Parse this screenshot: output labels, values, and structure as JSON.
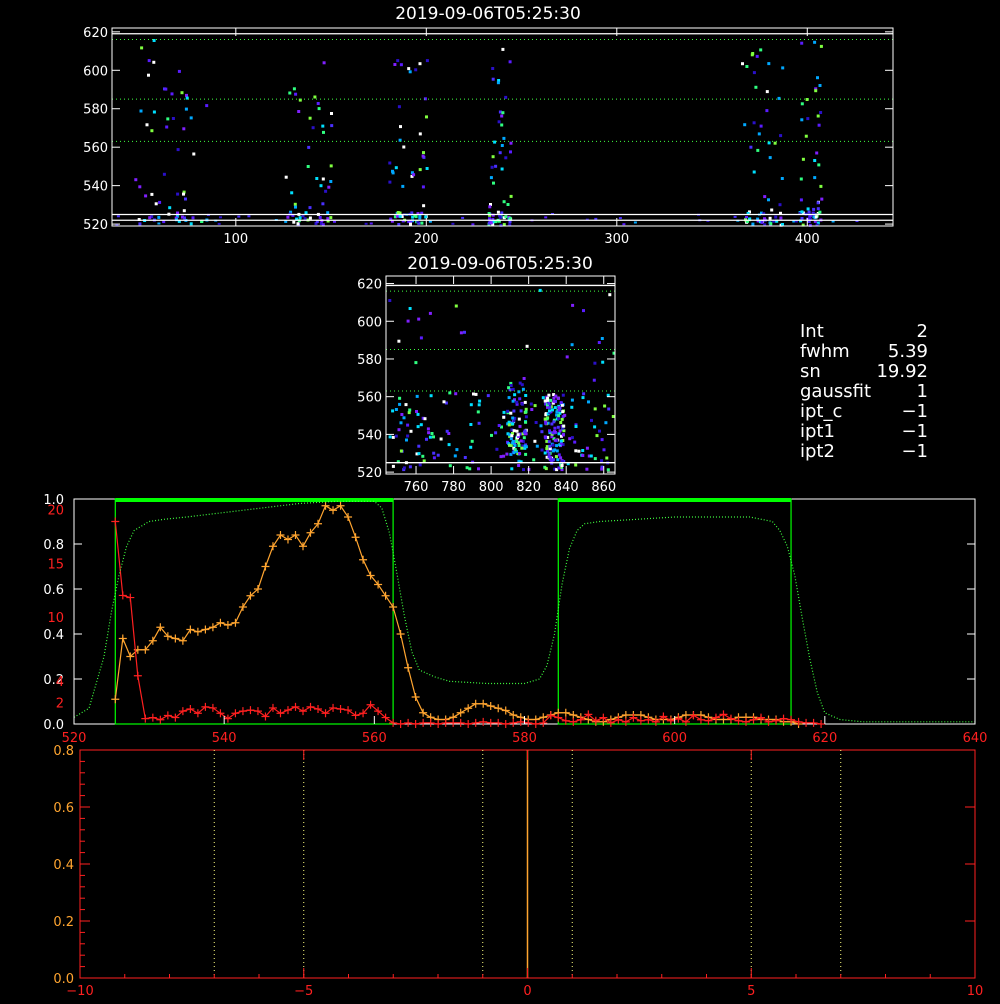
{
  "colors": {
    "axis": "#ffffff",
    "red": "#ff2020",
    "orange": "#ffa530",
    "green": "#00ff00",
    "green_dot": "#40ff40",
    "yellow_dot": "#ffff80"
  },
  "info_panel": [
    {
      "key": "Int",
      "value": "2"
    },
    {
      "key": "fwhm",
      "value": "5.39"
    },
    {
      "key": "sn",
      "value": "19.92"
    },
    {
      "key": "gaussfit",
      "value": "1"
    },
    {
      "key": "ipt_c",
      "value": "−1"
    },
    {
      "key": "ipt1",
      "value": "−1"
    },
    {
      "key": "ipt2",
      "value": "−1"
    }
  ],
  "chart_data": [
    {
      "id": "top_image",
      "type": "heatmap",
      "title": "2019-09-06T05:25:30",
      "xlim": [
        35,
        445
      ],
      "ylim": [
        519,
        622
      ],
      "x_ticks": [
        100,
        200,
        300,
        400
      ],
      "y_ticks": [
        520,
        540,
        560,
        580,
        600,
        620
      ],
      "solid_lines": [
        619,
        525,
        522
      ],
      "dotted_lines": [
        616,
        585,
        563
      ],
      "hot_columns": [
        {
          "x": 45,
          "w": 40
        },
        {
          "x": 125,
          "w": 25
        },
        {
          "x": 180,
          "w": 20
        },
        {
          "x": 232,
          "w": 12
        },
        {
          "x": 365,
          "w": 22
        },
        {
          "x": 395,
          "w": 12
        }
      ]
    },
    {
      "id": "zoom_image",
      "type": "heatmap",
      "title": "2019-09-06T05:25:30",
      "xlim": [
        744,
        866
      ],
      "ylim": [
        519,
        624
      ],
      "x_ticks": [
        760,
        780,
        800,
        820,
        840,
        860
      ],
      "y_ticks": [
        520,
        540,
        560,
        580,
        600,
        620
      ],
      "solid_lines": [
        619,
        525
      ],
      "dotted_lines": [
        616,
        585,
        563
      ]
    },
    {
      "id": "spectrum",
      "type": "line",
      "xlim": [
        520,
        640
      ],
      "x_ticks": [
        520,
        540,
        560,
        580,
        600,
        620,
        640
      ],
      "left_axis_white": {
        "ylim": [
          0,
          1
        ],
        "ticks": [
          0.0,
          0.2,
          0.4,
          0.6,
          0.8
        ],
        "tick_labels": [
          "0.0",
          "0.2",
          "0.4",
          "0.6",
          "0.8",
          "1.0"
        ]
      },
      "left_axis_red": {
        "ylim": [
          0,
          21
        ],
        "ticks": [
          2,
          4,
          10,
          15,
          20
        ],
        "tick_labels": [
          "2",
          "4",
          "10",
          "15",
          "20"
        ]
      },
      "pass_bands": [
        [
          525.5,
          562.5
        ],
        [
          584.5,
          615.5
        ]
      ],
      "series": [
        {
          "color": "orange",
          "axis": "white",
          "marker": "plus",
          "x": [
            525.5,
            526.5,
            527.5,
            528.5,
            529.5,
            530.5,
            531.5,
            532.5,
            533.5,
            534.5,
            535.5,
            536.5,
            537.5,
            538.5,
            539.5,
            540.5,
            541.5,
            542.5,
            543.5,
            544.5,
            545.5,
            546.5,
            547.5,
            548.5,
            549.5,
            550.5,
            551.5,
            552.5,
            553.5,
            554.5,
            555.5,
            556.5,
            557.5,
            558.5,
            559.5,
            560.5,
            561.5,
            562.5,
            563.5,
            564.5,
            565.5,
            566.5,
            567.5,
            568.5,
            569.5,
            570.5,
            571.5,
            572.5,
            573.5,
            574.5,
            575.5,
            576.5,
            577.5,
            578.5,
            579.5,
            580.5,
            581.5,
            582.5,
            583.5,
            584.5,
            585.5,
            586.5,
            587.5,
            588.5,
            589.5,
            590.5,
            591.5,
            592.5,
            593.5,
            594.5,
            595.5,
            596.5,
            597.5,
            598.5,
            599.5,
            600.5,
            601.5,
            602.5,
            603.5,
            604.5,
            605.5,
            606.5,
            607.5,
            608.5,
            609.5,
            610.5,
            611.5,
            612.5,
            613.5,
            614.5,
            615.5,
            616.5
          ],
          "y": [
            0.11,
            0.38,
            0.3,
            0.33,
            0.33,
            0.37,
            0.43,
            0.39,
            0.38,
            0.37,
            0.42,
            0.41,
            0.42,
            0.43,
            0.45,
            0.44,
            0.45,
            0.52,
            0.57,
            0.6,
            0.7,
            0.79,
            0.84,
            0.82,
            0.84,
            0.79,
            0.85,
            0.89,
            0.97,
            0.95,
            0.97,
            0.92,
            0.83,
            0.73,
            0.66,
            0.62,
            0.57,
            0.52,
            0.4,
            0.25,
            0.12,
            0.05,
            0.03,
            0.02,
            0.02,
            0.03,
            0.05,
            0.07,
            0.09,
            0.09,
            0.08,
            0.07,
            0.06,
            0.04,
            0.03,
            0.02,
            0.02,
            0.03,
            0.04,
            0.05,
            0.05,
            0.04,
            0.03,
            0.02,
            0.01,
            0.01,
            0.02,
            0.03,
            0.04,
            0.04,
            0.04,
            0.03,
            0.02,
            0.02,
            0.02,
            0.03,
            0.04,
            0.04,
            0.04,
            0.03,
            0.02,
            0.02,
            0.02,
            0.03,
            0.03,
            0.03,
            0.02,
            0.02,
            0.02,
            0.01,
            0.01,
            0.0
          ]
        },
        {
          "color": "red",
          "axis": "red",
          "marker": "plus",
          "x": [
            525.5,
            526.5,
            527.5,
            528.5,
            529.5,
            530.5,
            531.5,
            532.5,
            533.5,
            534.5,
            535.5,
            536.5,
            537.5,
            538.5,
            539.5,
            540.5,
            541.5,
            542.5,
            543.5,
            544.5,
            545.5,
            546.5,
            547.5,
            548.5,
            549.5,
            550.5,
            551.5,
            552.5,
            553.5,
            554.5,
            555.5,
            556.5,
            557.5,
            558.5,
            559.5,
            560.5,
            561.5,
            562.5,
            563.5,
            564.5,
            565.5,
            566.5,
            567.5,
            568.5,
            569.5,
            570.5,
            571.5,
            572.5,
            573.5,
            574.5,
            575.5,
            576.5,
            577.5,
            578.5,
            579.5,
            580.5,
            581.5,
            582.5,
            583.5,
            584.5,
            585.5,
            586.5,
            587.5,
            588.5,
            589.5,
            590.5,
            591.5,
            592.5,
            593.5,
            594.5,
            595.5,
            596.5,
            597.5,
            598.5,
            599.5,
            600.5,
            601.5,
            602.5,
            603.5,
            604.5,
            605.5,
            606.5,
            607.5,
            608.5,
            609.5,
            610.5,
            611.5,
            612.5,
            613.5,
            614.5,
            615.5,
            616.5,
            617.5,
            618.5,
            619.5
          ],
          "y": [
            18.9,
            12.0,
            11.8,
            4.5,
            0.5,
            0.6,
            0.4,
            0.8,
            0.6,
            1.2,
            1.4,
            1.0,
            1.6,
            1.5,
            1.0,
            0.5,
            1.0,
            1.2,
            1.3,
            1.2,
            0.7,
            1.5,
            1.0,
            1.3,
            1.6,
            1.2,
            1.6,
            1.4,
            1.0,
            1.5,
            1.4,
            1.3,
            0.8,
            1.0,
            1.8,
            1.2,
            0.6,
            0.1,
            0.0,
            0.1,
            0.0,
            0.1,
            0.1,
            0.0,
            0.1,
            0.1,
            0.1,
            0.0,
            0.1,
            0.2,
            0.1,
            0.1,
            0.0,
            0.1,
            0.2,
            0.1,
            0.0,
            0.1,
            0.8,
            0.6,
            0.3,
            0.2,
            0.4,
            0.9,
            0.3,
            0.6,
            0.1,
            0.4,
            0.2,
            0.6,
            0.3,
            0.4,
            0.2,
            0.7,
            0.3,
            0.5,
            0.2,
            0.8,
            0.4,
            0.3,
            0.6,
            0.9,
            0.5,
            0.3,
            0.2,
            0.4,
            0.6,
            0.2,
            0.3,
            0.5,
            0.4,
            0.2,
            0.1,
            0.1,
            0.0
          ]
        },
        {
          "color": "green_dot",
          "axis": "white",
          "marker": "none",
          "style": "dotted",
          "x": [
            520,
            522,
            524,
            525,
            526,
            527,
            528,
            530,
            532,
            535,
            540,
            545,
            550,
            555,
            560,
            561,
            562,
            563,
            564,
            565,
            566,
            568,
            570,
            575,
            580,
            582,
            583,
            584,
            585,
            586,
            587,
            588,
            590,
            595,
            600,
            605,
            610,
            613,
            614,
            615,
            616,
            617,
            618,
            619,
            620,
            622,
            625,
            630,
            640
          ],
          "y": [
            0.03,
            0.07,
            0.3,
            0.5,
            0.66,
            0.79,
            0.86,
            0.9,
            0.91,
            0.92,
            0.94,
            0.96,
            0.98,
            0.99,
            0.99,
            0.96,
            0.85,
            0.67,
            0.48,
            0.32,
            0.24,
            0.21,
            0.19,
            0.18,
            0.18,
            0.2,
            0.26,
            0.4,
            0.62,
            0.78,
            0.86,
            0.89,
            0.9,
            0.91,
            0.92,
            0.92,
            0.92,
            0.9,
            0.86,
            0.79,
            0.66,
            0.47,
            0.29,
            0.14,
            0.05,
            0.02,
            0.01,
            0.01,
            0.01
          ]
        }
      ]
    },
    {
      "id": "offset_panel",
      "type": "line",
      "xlim": [
        -10,
        10
      ],
      "ylim": [
        0,
        0.8
      ],
      "x_ticks": [
        -10,
        -5,
        0,
        5,
        10
      ],
      "y_ticks": [
        0.0,
        0.2,
        0.4,
        0.6,
        0.8
      ],
      "y_tick_labels": [
        "0.0",
        "0.2",
        "0.4",
        "0.6",
        "0.8"
      ],
      "vlines_dotted": [
        -7,
        -5,
        -1,
        1,
        5,
        7
      ],
      "vline_solid": 0
    }
  ]
}
